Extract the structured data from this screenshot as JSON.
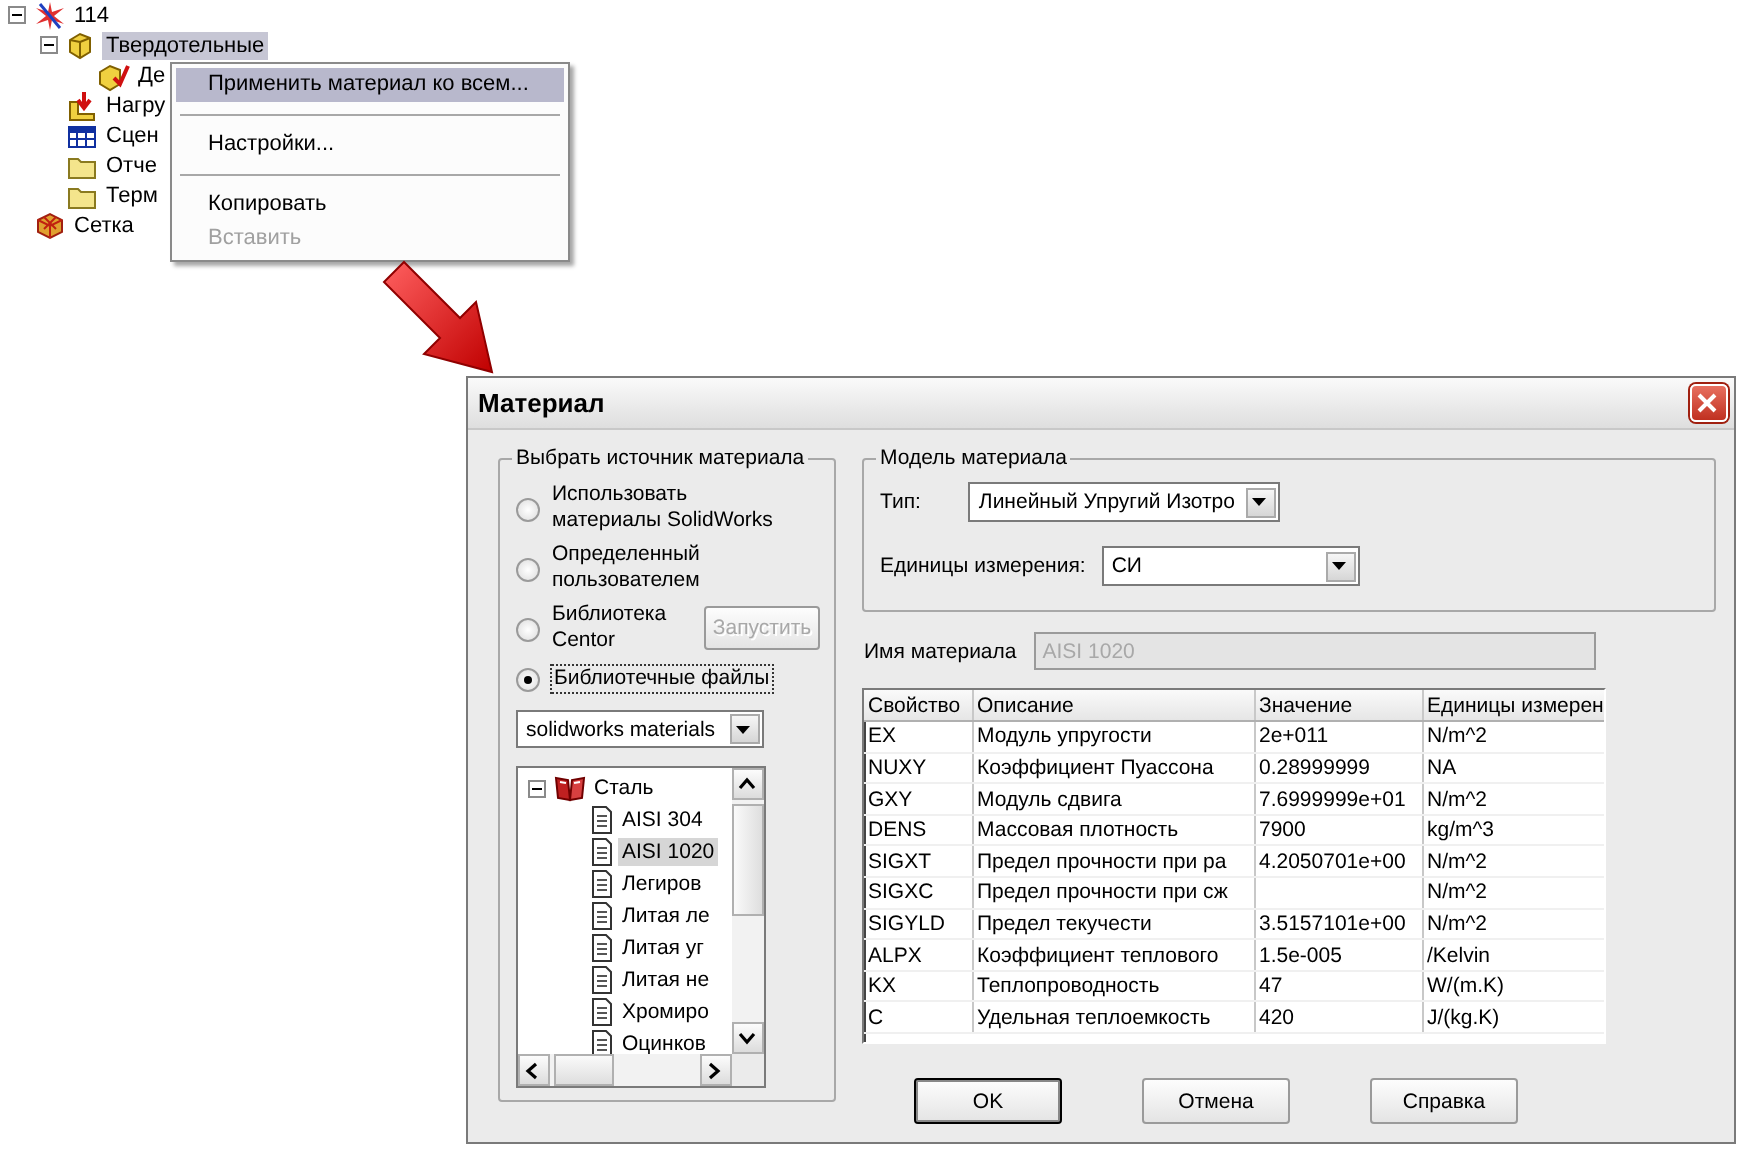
{
  "study_tree": {
    "items": [
      {
        "label": "114",
        "kind": "study",
        "selected": false,
        "expanded": true,
        "children": [
          {
            "label": "Твердотельные",
            "kind": "solids",
            "selected": true,
            "expanded": true,
            "children": [
              {
                "label": "Де",
                "kind": "part",
                "selected": false
              }
            ]
          },
          {
            "label": "Нагру",
            "kind": "loads",
            "selected": false
          },
          {
            "label": "Сцен",
            "kind": "scenario",
            "selected": false
          },
          {
            "label": "Отче",
            "kind": "folder",
            "selected": false
          },
          {
            "label": "Терм",
            "kind": "folder",
            "selected": false
          }
        ]
      },
      {
        "label": "Сетка",
        "kind": "mesh",
        "selected": false
      }
    ]
  },
  "context_menu": {
    "items": [
      {
        "kind": "item",
        "label": "Применить материал ко всем...",
        "highlighted": true,
        "disabled": false
      },
      {
        "kind": "separator"
      },
      {
        "kind": "item",
        "label": "Настройки...",
        "highlighted": false,
        "disabled": false
      },
      {
        "kind": "separator"
      },
      {
        "kind": "item",
        "label": "Копировать",
        "highlighted": false,
        "disabled": false
      },
      {
        "kind": "item",
        "label": "Вставить",
        "highlighted": false,
        "disabled": true
      }
    ]
  },
  "dialog": {
    "title": "Материал",
    "source_group": {
      "title": "Выбрать источник материала",
      "options": [
        {
          "label": "Использовать материалы SolidWorks",
          "selected": false
        },
        {
          "label": "Определенный пользователем",
          "selected": false
        },
        {
          "label": "Библиотека Centor",
          "selected": false,
          "button": {
            "label": "Запустить",
            "disabled": true
          }
        },
        {
          "label": "Библиотечные файлы",
          "selected": true
        }
      ],
      "library": {
        "value": "solidworks materials"
      },
      "material_tree": [
        {
          "label": "Сталь",
          "kind": "category",
          "selected": false,
          "expanded": true,
          "children": [
            {
              "label": "AISI 304",
              "kind": "material",
              "selected": false
            },
            {
              "label": "AISI 1020",
              "kind": "material",
              "selected": true
            },
            {
              "label": "Легиров",
              "kind": "material",
              "selected": false
            },
            {
              "label": "Литая ле",
              "kind": "material",
              "selected": false
            },
            {
              "label": "Литая уг",
              "kind": "material",
              "selected": false
            },
            {
              "label": "Литая не",
              "kind": "material",
              "selected": false
            },
            {
              "label": "Хромиро",
              "kind": "material",
              "selected": false
            },
            {
              "label": "Оцинков",
              "kind": "material",
              "selected": false
            }
          ]
        }
      ]
    },
    "model_group": {
      "title": "Модель материала",
      "type_label": "Тип:",
      "type_value": "Линейный Упругий Изотро",
      "units_label": "Единицы измерения:",
      "units_value": "СИ"
    },
    "material_name": {
      "label": "Имя материала",
      "value": "AISI 1020",
      "disabled": true
    },
    "properties_table": {
      "columns": [
        "Свойство",
        "Описание",
        "Значение",
        "Единицы измерен"
      ],
      "rows": [
        [
          "EX",
          "Модуль упругости",
          "2e+011",
          "N/m^2"
        ],
        [
          "NUXY",
          "Коэффициент Пуассона",
          "0.28999999",
          "NA"
        ],
        [
          "GXY",
          "Модуль сдвига",
          "7.6999999e+01",
          "N/m^2"
        ],
        [
          "DENS",
          "Массовая плотность",
          "7900",
          "kg/m^3"
        ],
        [
          "SIGXT",
          "Предел прочности при ра",
          "4.2050701e+00",
          "N/m^2"
        ],
        [
          "SIGXC",
          "Предел прочности при сж",
          "",
          "N/m^2"
        ],
        [
          "SIGYLD",
          "Предел текучести",
          "3.5157101e+00",
          "N/m^2"
        ],
        [
          "ALPX",
          "Коэффициент теплового",
          "1.5e-005",
          "/Kelvin"
        ],
        [
          "KX",
          "Теплопроводность",
          "47",
          "W/(m.K)"
        ],
        [
          "C",
          "Удельная теплоемкость",
          "420",
          "J/(kg.K)"
        ]
      ]
    },
    "buttons": [
      {
        "label": "OK",
        "default": true
      },
      {
        "label": "Отмена",
        "default": false
      },
      {
        "label": "Справка",
        "default": false
      }
    ]
  }
}
